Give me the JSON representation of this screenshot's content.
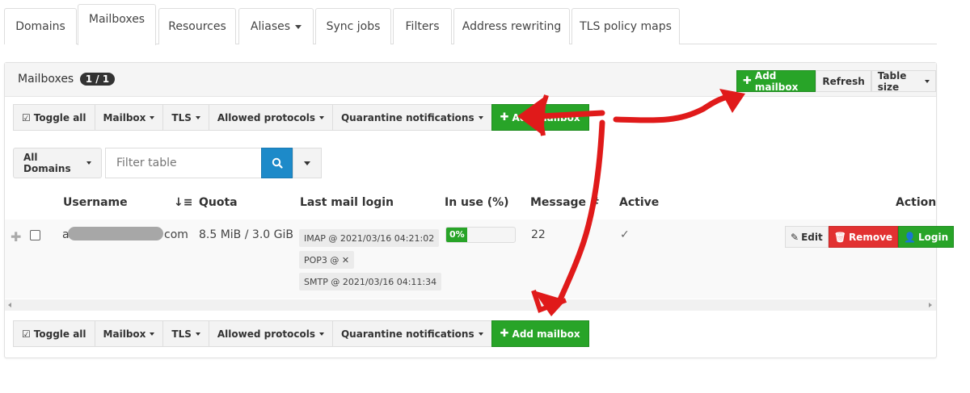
{
  "tabs": [
    {
      "label": "Domains",
      "active": false
    },
    {
      "label": "Mailboxes",
      "active": true
    },
    {
      "label": "Resources",
      "active": false
    },
    {
      "label": "Aliases",
      "active": false,
      "dropdown": true
    },
    {
      "label": "Sync jobs",
      "active": false
    },
    {
      "label": "Filters",
      "active": false
    },
    {
      "label": "Address rewriting",
      "active": false
    },
    {
      "label": "TLS policy maps",
      "active": false
    }
  ],
  "panel": {
    "title": "Mailboxes",
    "badge": "1 / 1",
    "add_label": "Add mailbox",
    "refresh_label": "Refresh",
    "table_size_label": "Table size"
  },
  "toolbar": {
    "toggle_all": "Toggle all",
    "mailbox": "Mailbox",
    "tls": "TLS",
    "allowed_protocols": "Allowed protocols",
    "quarantine": "Quarantine notifications",
    "add_mailbox": "Add mailbox"
  },
  "filter": {
    "domain_select": "All Domains",
    "placeholder": "Filter table"
  },
  "table": {
    "headers": {
      "username": "Username",
      "quota": "Quota",
      "last_login": "Last mail login",
      "in_use": "In use (%)",
      "messages": "Message #",
      "active": "Active",
      "action": "Action"
    },
    "row": {
      "username_prefix": "a",
      "username_suffix": "com",
      "quota": "8.5 MiB / 3.0 GiB",
      "logins": [
        "IMAP @ 2021/03/16 04:21:02",
        "POP3 @ ✕",
        "SMTP @ 2021/03/16 04:11:34"
      ],
      "in_use_percent": 0,
      "in_use_label": "0%",
      "messages": "22",
      "active": "✓",
      "edit": "Edit",
      "remove": "Remove",
      "login": "Login"
    }
  },
  "colors": {
    "green": "#28a428",
    "red": "#e23131",
    "blue": "#1d8ac9",
    "annotation": "#e01a1a"
  }
}
